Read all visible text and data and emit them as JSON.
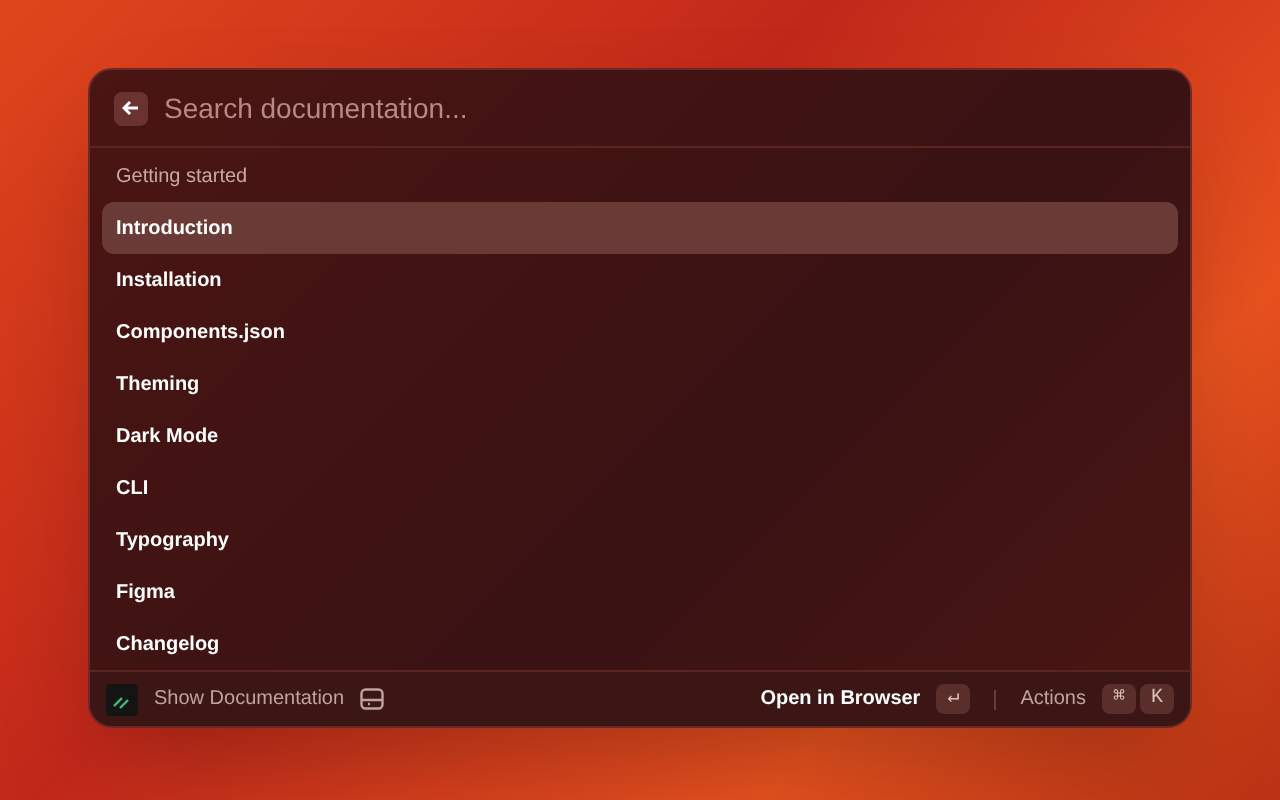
{
  "search": {
    "placeholder": "Search documentation..."
  },
  "section": {
    "title": "Getting started"
  },
  "items": [
    {
      "label": "Introduction",
      "selected": true
    },
    {
      "label": "Installation",
      "selected": false
    },
    {
      "label": "Components.json",
      "selected": false
    },
    {
      "label": "Theming",
      "selected": false
    },
    {
      "label": "Dark Mode",
      "selected": false
    },
    {
      "label": "CLI",
      "selected": false
    },
    {
      "label": "Typography",
      "selected": false
    },
    {
      "label": "Figma",
      "selected": false
    },
    {
      "label": "Changelog",
      "selected": false
    }
  ],
  "footer": {
    "title": "Show Documentation",
    "primary_action": "Open in Browser",
    "primary_key": "↵",
    "actions_label": "Actions",
    "action_keys": [
      "⌘",
      "K"
    ]
  }
}
